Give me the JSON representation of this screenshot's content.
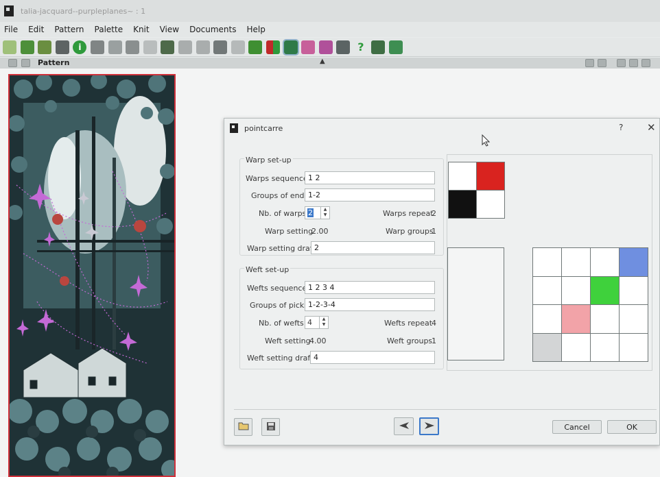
{
  "window": {
    "title": "talia-jacquard--purpleplanes~ : 1"
  },
  "menu": [
    "File",
    "Edit",
    "Pattern",
    "Palette",
    "Knit",
    "View",
    "Documents",
    "Help"
  ],
  "toolbar": [
    {
      "icon": "new-file-icon",
      "color": "#9fc07a"
    },
    {
      "icon": "open-folder-icon",
      "color": "#4d8f3a"
    },
    {
      "icon": "reload-icon",
      "color": "#6a8e40"
    },
    {
      "icon": "save-icon",
      "color": "#5d6363"
    },
    {
      "icon": "info-icon",
      "color": "#2f9a3c"
    },
    {
      "icon": "print-icon",
      "color": "#808585"
    },
    {
      "icon": "print-preview-icon",
      "color": "#9aa0a0"
    },
    {
      "icon": "cut-icon",
      "color": "#8a8f8f"
    },
    {
      "icon": "copy-icon",
      "color": "#b9bdbd"
    },
    {
      "icon": "paste-icon",
      "color": "#4e6a4a"
    },
    {
      "icon": "undo-icon",
      "color": "#a9adad"
    },
    {
      "icon": "redo-icon",
      "color": "#a9adad"
    },
    {
      "icon": "transform-icon",
      "color": "#727878"
    },
    {
      "icon": "image-icon",
      "color": "#b5b9b9"
    },
    {
      "icon": "puzzle-icon",
      "color": "#3f8f32"
    },
    {
      "icon": "grid-color-icon",
      "color": "#c02a2a"
    },
    {
      "icon": "weave-icon",
      "color": "#2f7a48"
    },
    {
      "icon": "palette-doc-icon",
      "color": "#c7609a"
    },
    {
      "icon": "palette-doc2-icon",
      "color": "#b0509a"
    },
    {
      "icon": "camera-icon",
      "color": "#5b6464"
    },
    {
      "icon": "help-icon",
      "color": "#2d9a3a"
    },
    {
      "icon": "book-icon",
      "color": "#3f6e44"
    },
    {
      "icon": "loom-icon",
      "color": "#3e8e52"
    }
  ],
  "panel": {
    "title": "Pattern"
  },
  "dialog": {
    "title": "pointcarre",
    "help": "?",
    "close": "✕",
    "warp": {
      "legend": "Warp set-up",
      "seq_label": "Warps sequence",
      "seq_value": "1 2",
      "groups_label": "Groups of ends",
      "groups_value": "1-2",
      "nb_label": "Nb. of warps",
      "nb_value": "2",
      "repeat_label": "Warps repeat",
      "repeat_value": "2",
      "setting_label": "Warp setting",
      "setting_value": "2.00",
      "wgroups_label": "Warp groups",
      "wgroups_value": "1",
      "draft_label": "Warp setting draft",
      "draft_value": "2"
    },
    "weft": {
      "legend": "Weft set-up",
      "seq_label": "Wefts sequence",
      "seq_value": "1 2 3 4",
      "groups_label": "Groups of picks",
      "groups_value": "1-2-3-4",
      "nb_label": "Nb. of wefts",
      "nb_value": "4",
      "repeat_label": "Wefts repeat",
      "repeat_value": "4",
      "setting_label": "Weft setting",
      "setting_value": "4.00",
      "wgroups_label": "Weft groups",
      "wgroups_value": "1",
      "draft_label": "Weft setting draft",
      "draft_value": "4"
    },
    "warp_draft": [
      [
        "#ffffff",
        "#d9231f"
      ],
      [
        "#111111",
        "#ffffff"
      ]
    ],
    "weft_draft": [
      [
        "#ffffff",
        "#ffffff",
        "#ffffff",
        "#6f8fe0"
      ],
      [
        "#ffffff",
        "#ffffff",
        "#3fd13c",
        "#ffffff"
      ],
      [
        "#ffffff",
        "#f2a3a8",
        "#ffffff",
        "#ffffff"
      ],
      [
        "#d3d5d6",
        "#ffffff",
        "#ffffff",
        "#ffffff"
      ]
    ],
    "buttons": {
      "cancel": "Cancel",
      "ok": "OK"
    }
  }
}
